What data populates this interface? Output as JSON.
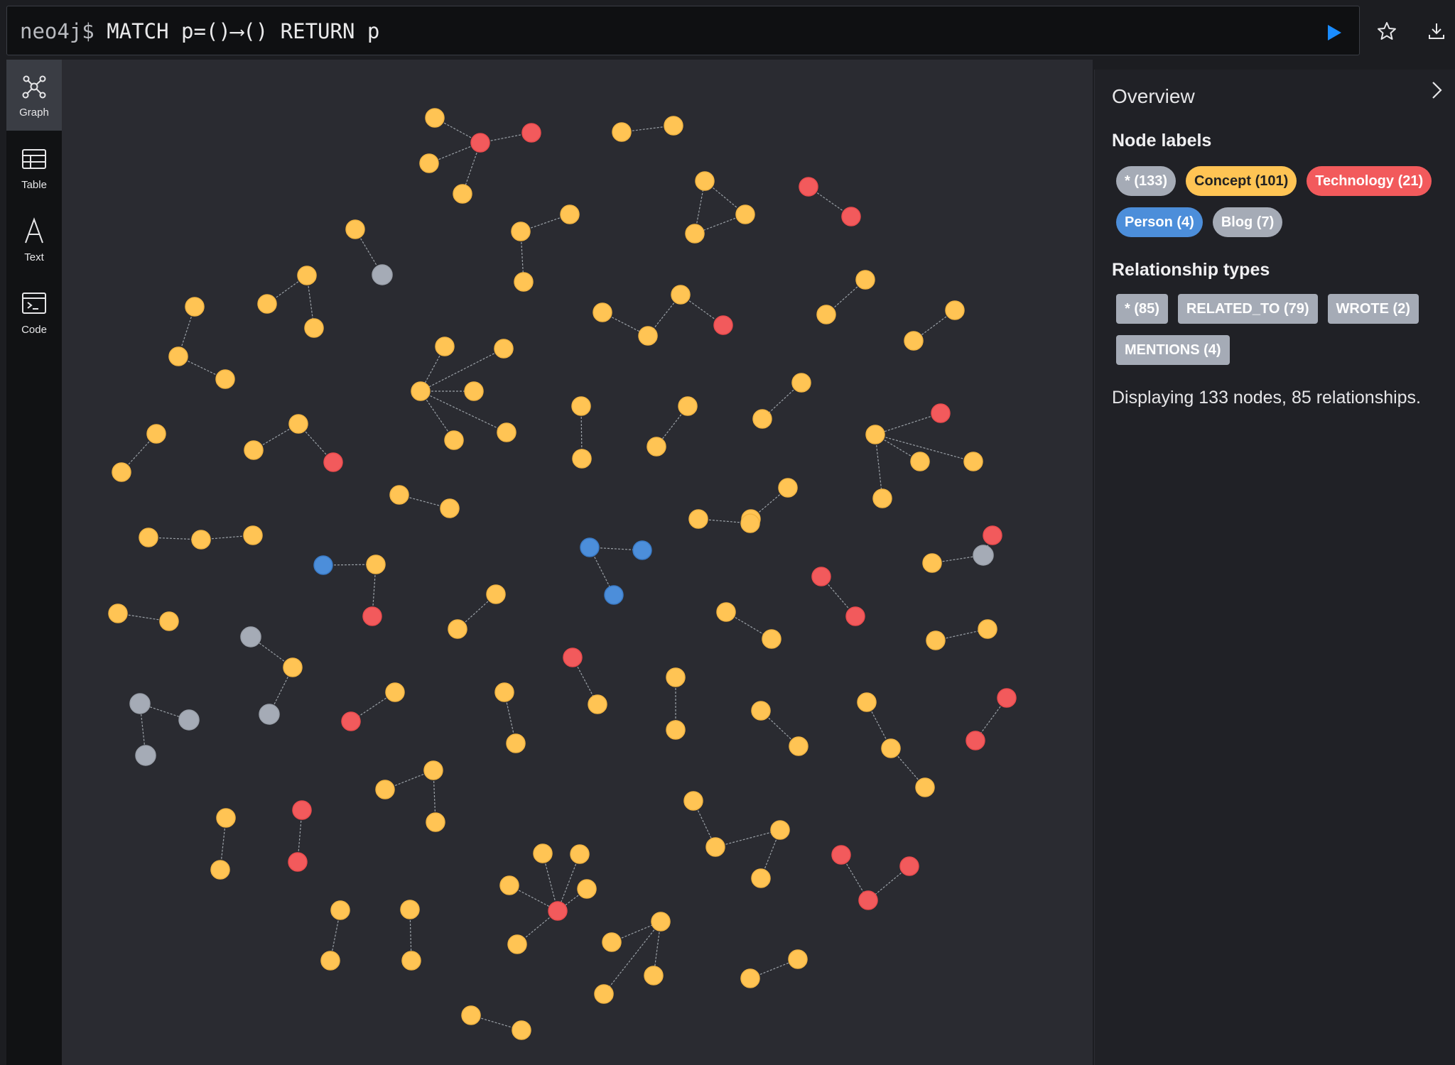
{
  "query": {
    "prompt": "neo4j$",
    "text": "MATCH p=()⟶() RETURN p"
  },
  "toolbar": {
    "run_icon": "play-icon",
    "favorite_icon": "star-icon",
    "download_icon": "download-icon"
  },
  "sidebar": {
    "items": [
      {
        "label": "Graph",
        "icon": "graph-icon",
        "active": true
      },
      {
        "label": "Table",
        "icon": "table-icon",
        "active": false
      },
      {
        "label": "Text",
        "icon": "text-icon",
        "active": false
      },
      {
        "label": "Code",
        "icon": "code-icon",
        "active": false
      }
    ]
  },
  "overview": {
    "title": "Overview",
    "node_labels_title": "Node labels",
    "node_labels": [
      {
        "label": "* (133)",
        "color": "#a5abb6"
      },
      {
        "label": "Concept (101)",
        "color": "#ffc454"
      },
      {
        "label": "Technology (21)",
        "color": "#f25a5c"
      },
      {
        "label": "Person (4)",
        "color": "#4c8eda"
      },
      {
        "label": "Blog (7)",
        "color": "#a5abb6"
      }
    ],
    "relationship_types_title": "Relationship types",
    "relationship_types": [
      {
        "label": "* (85)",
        "color": "#a5abb6"
      },
      {
        "label": "RELATED_TO (79)",
        "color": "#a5abb6"
      },
      {
        "label": "WROTE (2)",
        "color": "#a5abb6"
      },
      {
        "label": "MENTIONS (4)",
        "color": "#a5abb6"
      }
    ],
    "status": "Displaying 133 nodes, 85 relationships."
  },
  "colors": {
    "concept": "#ffc454",
    "technology": "#f25a5c",
    "person": "#4c8eda",
    "blog": "#a5abb6",
    "edge": "#9aa0a6"
  }
}
